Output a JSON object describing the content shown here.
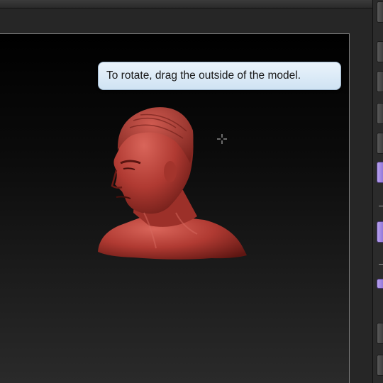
{
  "tooltip": {
    "text": "To rotate, drag the outside of the model."
  },
  "icons": {
    "cursor": "crosshair-cursor-icon",
    "model": "red-head-bust-model"
  },
  "colors": {
    "viewport_top": "#000000",
    "viewport_bottom": "#2a2a2a",
    "tooltip_bg": "#dbeaf7",
    "model_color": "#b03a32",
    "accent_purple": "#a38ae6"
  }
}
